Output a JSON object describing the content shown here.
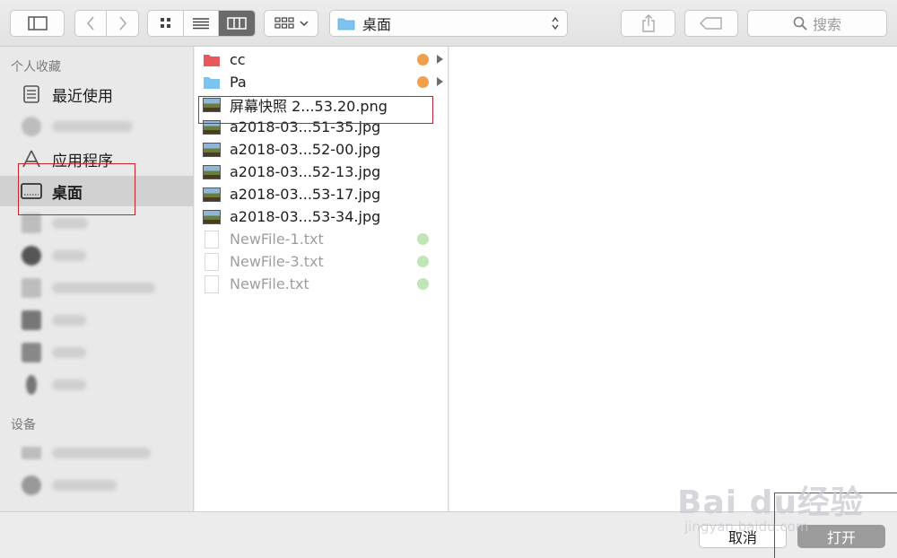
{
  "toolbar": {
    "location": "桌面",
    "search_placeholder": "搜索",
    "icons": {
      "sidebar_toggle": "sidebar-toggle-icon",
      "back": "chevron-left-icon",
      "forward": "chevron-right-icon",
      "icon_view": "grid-view-icon",
      "list_view": "list-view-icon",
      "column_view": "column-view-icon",
      "group": "group-icon",
      "share": "share-icon",
      "tag": "tag-icon",
      "search": "search-icon"
    },
    "view_mode": "column"
  },
  "sidebar": {
    "favorites_header": "个人收藏",
    "devices_header": "设备",
    "items": [
      {
        "label": "最近使用",
        "icon": "recents-icon"
      },
      {
        "label": "",
        "icon": "icloud-icon"
      },
      {
        "label": "应用程序",
        "icon": "applications-icon"
      },
      {
        "label": "桌面",
        "icon": "desktop-icon"
      },
      {
        "label": "",
        "icon": "documents-icon"
      },
      {
        "label": "",
        "icon": "downloads-icon"
      },
      {
        "label": "",
        "icon": "home-icon"
      },
      {
        "label": "",
        "icon": "pictures-icon"
      },
      {
        "label": "",
        "icon": "movies-icon"
      },
      {
        "label": "",
        "icon": "music-icon"
      }
    ],
    "devices": [
      {
        "label": "",
        "icon": "laptop-icon"
      },
      {
        "label": "",
        "icon": "disk-icon"
      }
    ],
    "selected": "桌面"
  },
  "files": [
    {
      "name": "cc",
      "kind": "folder-red",
      "tag": "#f0a04b",
      "expandable": true
    },
    {
      "name": "Pa",
      "kind": "folder-blue",
      "tag": "#f0a04b",
      "expandable": true
    },
    {
      "name": "屏幕快照 2...53.20.png",
      "kind": "image"
    },
    {
      "name": "a2018-03...51-35.jpg",
      "kind": "image"
    },
    {
      "name": "a2018-03...52-00.jpg",
      "kind": "image"
    },
    {
      "name": "a2018-03...52-13.jpg",
      "kind": "image"
    },
    {
      "name": "a2018-03...53-17.jpg",
      "kind": "image"
    },
    {
      "name": "a2018-03...53-34.jpg",
      "kind": "image"
    },
    {
      "name": "NewFile-1.txt",
      "kind": "text",
      "dim": true,
      "tag": "#bfe6b4"
    },
    {
      "name": "NewFile-3.txt",
      "kind": "text",
      "dim": true,
      "tag": "#bfe6b4"
    },
    {
      "name": "NewFile.txt",
      "kind": "text",
      "dim": true,
      "tag": "#bfe6b4"
    }
  ],
  "buttons": {
    "cancel": "取消",
    "open": "打开"
  },
  "watermark": {
    "main": "Bai du经验",
    "sub": "jingyan.baidu.com"
  },
  "colors": {
    "selection": "#d1d1d1",
    "annotation": "#c8222e",
    "folder_red": "#e8585a",
    "folder_blue": "#7cc3ef"
  }
}
